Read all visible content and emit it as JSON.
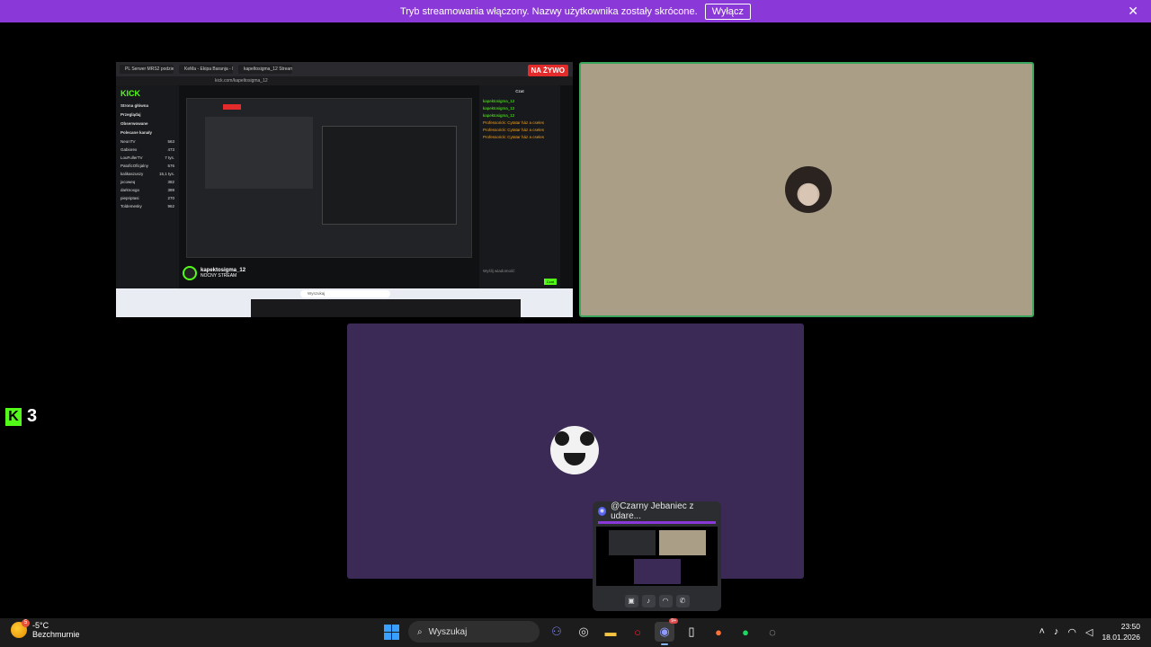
{
  "banner": {
    "message": "Tryb streamowania włączony. Nazwy użytkownika zostały skrócone.",
    "button_label": "Wyłącz",
    "close_glyph": "✕"
  },
  "stream_tile": {
    "live_badge": "NA ŻYWO",
    "browser": {
      "tabs": [
        "PL Serwer MRS2 podzielonie kaca - ok",
        "KeMa - Ekipa Baranja - Moim Smarthi",
        "kapeltosigma_12 Stream - Kick"
      ],
      "url": "kick.com/kapeltosigma_12"
    },
    "kick": {
      "logo": "KICK",
      "nav": [
        "Strona główna",
        "Przeglądaj",
        "Obserwowane"
      ],
      "section": "Polecane kanały",
      "channels": [
        {
          "name": "NeonTV",
          "viewers": "563"
        },
        {
          "name": "Gabiorex",
          "viewers": "473"
        },
        {
          "name": "LouFullerTV",
          "viewers": "7 tys."
        },
        {
          "name": "PatoficOficjalny",
          "viewers": "576"
        },
        {
          "name": "kalikaszuszy",
          "viewers": "15,1 tys."
        },
        {
          "name": "jxcoweq",
          "viewers": "382"
        },
        {
          "name": "darknoxgo",
          "viewers": "389"
        },
        {
          "name": "piepriptasi",
          "viewers": "270"
        },
        {
          "name": "Toldemesky",
          "viewers": "962"
        }
      ],
      "streamer_name": "kapektosigma_12",
      "stream_title": "NOCNY STREAM",
      "chat_title": "Czat",
      "chat_lines": [
        "kapektosigma_12",
        "kapektosigma_12",
        "kapektosigma_12",
        "Professorick: Cytatar ház a cseles",
        "Professorick: Cytatar ház a cseles",
        "Professorick: Cytatar ház a cseles"
      ],
      "chat_placeholder": "Wyślij wiadomość",
      "chat_button": "Czat",
      "login_button": "Zaloguj się",
      "signup_button": "Zarejestruj się",
      "search_placeholder": "Wyszukaj"
    },
    "mini_search": "Wyszukaj"
  },
  "side_label": {
    "logo_letter": "K",
    "count": "3"
  },
  "popup": {
    "title": "@Czarny Jebaniec z udare...",
    "controls": [
      "camera-icon",
      "mic-icon",
      "headphones-icon",
      "leave-call-icon"
    ]
  },
  "taskbar": {
    "weather_temp": "-5°C",
    "weather_desc": "Bezchmurnie",
    "weather_badge": "5",
    "search_label": "Wyszukaj",
    "discord_badge": "9+",
    "time": "23:50",
    "date": "18.01.2026"
  }
}
